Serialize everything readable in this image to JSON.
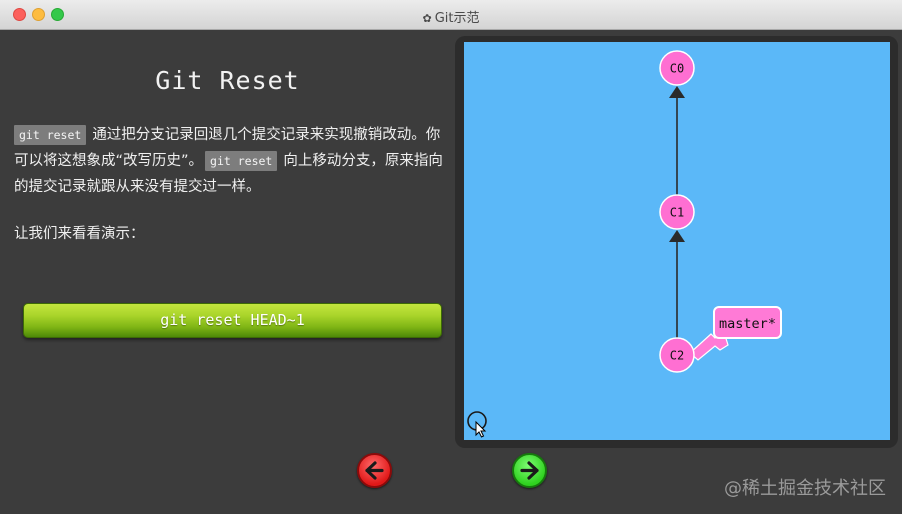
{
  "window": {
    "title": "Git示范",
    "gear_glyph": "✿"
  },
  "lesson": {
    "heading": "Git Reset",
    "code_term": "git reset",
    "text_part1": "通过把分支记录回退几个提交记录来实现撤销改动。你可以将这想象成“改写历史”。",
    "text_part2": "向上移动分支，原来指向的提交记录就跟从来没有提交过一样。",
    "text_part3": "让我们来看看演示：",
    "command_button": "git reset HEAD~1"
  },
  "graph": {
    "commits": [
      {
        "id": "C0",
        "label": "C0"
      },
      {
        "id": "C1",
        "label": "C1"
      },
      {
        "id": "C2",
        "label": "C2"
      }
    ],
    "branch": {
      "label": "master*",
      "target": "C2"
    },
    "colors": {
      "background": "#5bb8f8",
      "commit_fill": "#ff6fd2",
      "commit_stroke": "#ffffff",
      "edge": "#2a2a2a",
      "branch_fill": "#ff7ad6"
    }
  },
  "nav": {
    "back_icon": "left-arrow-icon",
    "forward_icon": "right-arrow-icon"
  },
  "watermark": "@稀土掘金技术社区"
}
